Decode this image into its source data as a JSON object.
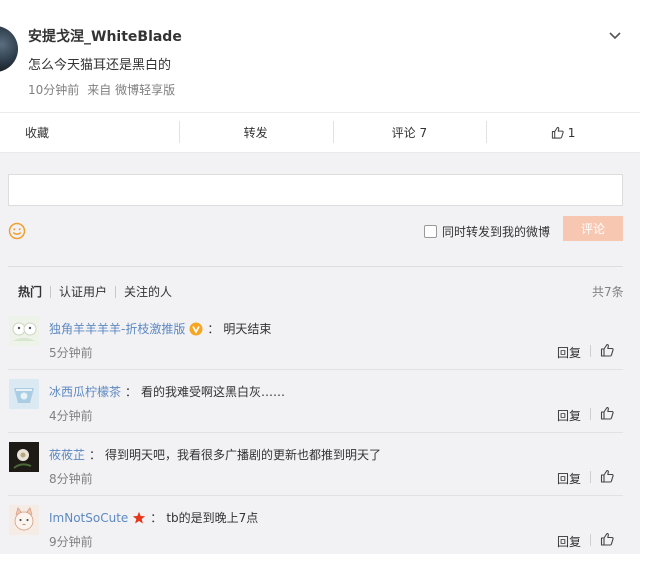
{
  "post": {
    "author": "安提戈涅_WhiteBlade",
    "text": "怎么今天猫耳还是黑白的",
    "time": "10分钟前",
    "source": "来自 微博轻享版"
  },
  "actions": {
    "favorite": "收藏",
    "forward": "转发",
    "comment": "评论 7",
    "like_count": "1"
  },
  "composer": {
    "input_value": "",
    "forward_label": "同时转发到我的微博",
    "submit_label": "评论"
  },
  "tabs": [
    "热门",
    "认证用户",
    "关注的人"
  ],
  "total": "共7条",
  "comments": [
    {
      "name": "独角羊羊羊羊-折枝激推版",
      "colon": "：",
      "text": "明天结束",
      "time": "5分钟前",
      "reply": "回复",
      "badge": "vip-v-icon"
    },
    {
      "name": "冰西瓜柠檬茶",
      "colon": "：",
      "text": "看的我难受啊这黑白灰……",
      "time": "4分钟前",
      "reply": "回复"
    },
    {
      "name": "莜莜芷",
      "colon": "：",
      "text": "得到明天吧，我看很多广播剧的更新也都推到明天了",
      "time": "8分钟前",
      "reply": "回复"
    },
    {
      "name": "ImNotSoCute",
      "colon": "：",
      "text": "tb的是到晚上7点",
      "time": "9分钟前",
      "reply": "回复",
      "badge": "star-icon"
    }
  ],
  "colors": {
    "link": "#5d89c1",
    "submit_disabled": "#f8c7b1",
    "area_bg": "#f2f2f5",
    "vip_badge": "#f5a623",
    "star_badge": "#e8361b"
  }
}
